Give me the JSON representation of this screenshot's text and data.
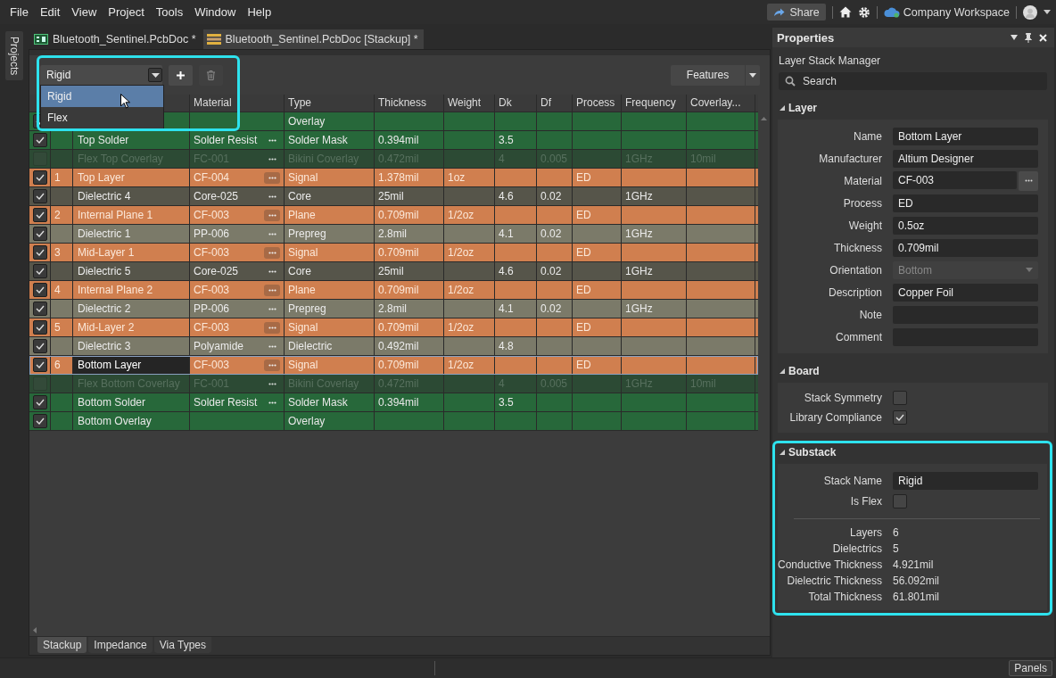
{
  "menu": [
    {
      "label": "File"
    },
    {
      "label": "Edit"
    },
    {
      "label": "View"
    },
    {
      "label": "Project"
    },
    {
      "label": "Tools"
    },
    {
      "label": "Window"
    },
    {
      "label": "Help"
    }
  ],
  "top_right": {
    "share": "Share",
    "workspace": "Company Workspace"
  },
  "side_tab": "Projects",
  "doc_tabs": [
    {
      "label": "Bluetooth_Sentinel.PcbDoc *",
      "kind": "pcb",
      "selected": false
    },
    {
      "label": "Bluetooth_Sentinel.PcbDoc [Stackup] *",
      "kind": "stackup",
      "selected": true
    }
  ],
  "substack_selector": {
    "value": "Rigid",
    "highlighted": true,
    "options": [
      {
        "label": "Rigid",
        "selected": true
      },
      {
        "label": "Flex",
        "selected": false
      }
    ]
  },
  "features_button": "Features",
  "table": {
    "columns": [
      "Material",
      "Type",
      "Thickness",
      "Weight",
      "Dk",
      "Df",
      "Process",
      "Frequency",
      "Coverlay..."
    ],
    "rows": [
      {
        "kind": "overlay",
        "checked": true,
        "disabled": false,
        "selected": false,
        "type": "Overlay"
      },
      {
        "kind": "solder",
        "checked": true,
        "disabled": false,
        "selected": false,
        "name": "Top Solder",
        "material": "Solder Resist",
        "type": "Solder Mask",
        "thickness": "0.394mil",
        "dk": "3.5"
      },
      {
        "kind": "coverlay",
        "checked": false,
        "disabled": true,
        "selected": false,
        "name": "Flex Top Coverlay",
        "material": "FC-001",
        "type": "Bikini Coverlay",
        "thickness": "0.472mil",
        "dk": "4",
        "df": "0.005",
        "frequency": "1GHz",
        "coverlay": "10mil"
      },
      {
        "kind": "copper",
        "checked": true,
        "disabled": false,
        "selected": false,
        "number": "1",
        "name": "Top Layer",
        "material": "CF-004",
        "type": "Signal",
        "thickness": "1.378mil",
        "weight": "1oz",
        "process": "ED"
      },
      {
        "kind": "core",
        "checked": true,
        "disabled": false,
        "selected": false,
        "name": "Dielectric 4",
        "material": "Core-025",
        "type": "Core",
        "thickness": "25mil",
        "dk": "4.6",
        "df": "0.02",
        "frequency": "1GHz"
      },
      {
        "kind": "copper",
        "checked": true,
        "disabled": false,
        "selected": false,
        "number": "2",
        "name": "Internal Plane 1",
        "material": "CF-003",
        "type": "Plane",
        "thickness": "0.709mil",
        "weight": "1/2oz",
        "process": "ED"
      },
      {
        "kind": "prepreg",
        "checked": true,
        "disabled": false,
        "selected": false,
        "name": "Dielectric 1",
        "material": "PP-006",
        "type": "Prepreg",
        "thickness": "2.8mil",
        "dk": "4.1",
        "df": "0.02",
        "frequency": "1GHz"
      },
      {
        "kind": "copper",
        "checked": true,
        "disabled": false,
        "selected": false,
        "number": "3",
        "name": "Mid-Layer 1",
        "material": "CF-003",
        "type": "Signal",
        "thickness": "0.709mil",
        "weight": "1/2oz",
        "process": "ED"
      },
      {
        "kind": "core",
        "checked": true,
        "disabled": false,
        "selected": false,
        "name": "Dielectric 5",
        "material": "Core-025",
        "type": "Core",
        "thickness": "25mil",
        "dk": "4.6",
        "df": "0.02",
        "frequency": "1GHz"
      },
      {
        "kind": "copper",
        "checked": true,
        "disabled": false,
        "selected": false,
        "number": "4",
        "name": "Internal Plane 2",
        "material": "CF-003",
        "type": "Plane",
        "thickness": "0.709mil",
        "weight": "1/2oz",
        "process": "ED"
      },
      {
        "kind": "prepreg",
        "checked": true,
        "disabled": false,
        "selected": false,
        "name": "Dielectric 2",
        "material": "PP-006",
        "type": "Prepreg",
        "thickness": "2.8mil",
        "dk": "4.1",
        "df": "0.02",
        "frequency": "1GHz"
      },
      {
        "kind": "copper",
        "checked": true,
        "disabled": false,
        "selected": false,
        "number": "5",
        "name": "Mid-Layer 2",
        "material": "CF-003",
        "type": "Signal",
        "thickness": "0.709mil",
        "weight": "1/2oz",
        "process": "ED"
      },
      {
        "kind": "dielectric",
        "checked": true,
        "disabled": false,
        "selected": false,
        "name": "Dielectric 3",
        "material": "Polyamide",
        "type": "Dielectric",
        "thickness": "0.492mil",
        "dk": "4.8"
      },
      {
        "kind": "copper",
        "checked": true,
        "disabled": false,
        "selected": true,
        "number": "6",
        "name": "Bottom Layer",
        "material": "CF-003",
        "type": "Signal",
        "thickness": "0.709mil",
        "weight": "1/2oz",
        "process": "ED"
      },
      {
        "kind": "coverlay",
        "checked": false,
        "disabled": true,
        "selected": false,
        "name": "Flex Bottom Coverlay",
        "material": "FC-001",
        "type": "Bikini Coverlay",
        "thickness": "0.472mil",
        "dk": "4",
        "df": "0.005",
        "frequency": "1GHz",
        "coverlay": "10mil"
      },
      {
        "kind": "solder",
        "checked": true,
        "disabled": false,
        "selected": false,
        "name": "Bottom Solder",
        "material": "Solder Resist",
        "type": "Solder Mask",
        "thickness": "0.394mil",
        "dk": "3.5"
      },
      {
        "kind": "overlay",
        "checked": true,
        "disabled": false,
        "selected": false,
        "name": "Bottom Overlay",
        "type": "Overlay"
      }
    ]
  },
  "bottom_tabs": [
    {
      "label": "Stackup",
      "selected": true
    },
    {
      "label": "Impedance",
      "selected": false
    },
    {
      "label": "Via Types",
      "selected": false
    }
  ],
  "properties": {
    "title": "Properties",
    "subtitle": "Layer Stack Manager",
    "search_placeholder": "Search",
    "sections": [
      {
        "title": "Layer",
        "highlighted": false,
        "rows": [
          {
            "kind": "text",
            "label": "Name",
            "value": "Bottom Layer"
          },
          {
            "kind": "text",
            "label": "Manufacturer",
            "value": "Altium Designer"
          },
          {
            "kind": "browse",
            "label": "Material",
            "value": "CF-003"
          },
          {
            "kind": "text",
            "label": "Process",
            "value": "ED"
          },
          {
            "kind": "text",
            "label": "Weight",
            "value": "0.5oz"
          },
          {
            "kind": "text",
            "label": "Thickness",
            "value": "0.709mil"
          },
          {
            "kind": "select",
            "label": "Orientation",
            "value": "Bottom",
            "disabled": true
          },
          {
            "kind": "text",
            "label": "Description",
            "value": "Copper Foil"
          },
          {
            "kind": "text",
            "label": "Note"
          },
          {
            "kind": "text",
            "label": "Comment"
          }
        ]
      },
      {
        "title": "Board",
        "highlighted": false,
        "rows": [
          {
            "kind": "check",
            "label": "Stack Symmetry",
            "checked": false
          },
          {
            "kind": "check",
            "label": "Library Compliance",
            "checked": true
          }
        ]
      },
      {
        "title": "Substack",
        "highlighted": true,
        "rows": [
          {
            "kind": "text",
            "label": "Stack Name",
            "value": "Rigid"
          },
          {
            "kind": "check",
            "label": "Is Flex",
            "checked": false
          },
          {
            "kind": "divider"
          },
          {
            "kind": "info",
            "label": "Layers",
            "value": "6"
          },
          {
            "kind": "info",
            "label": "Dielectrics",
            "value": "5"
          },
          {
            "kind": "info",
            "label": "Conductive Thickness",
            "value": "4.921mil"
          },
          {
            "kind": "info",
            "label": "Dielectric Thickness",
            "value": "56.092mil"
          },
          {
            "kind": "info",
            "label": "Total Thickness",
            "value": "61.801mil"
          }
        ]
      }
    ]
  },
  "status_bar": {
    "panels_button": "Panels"
  }
}
